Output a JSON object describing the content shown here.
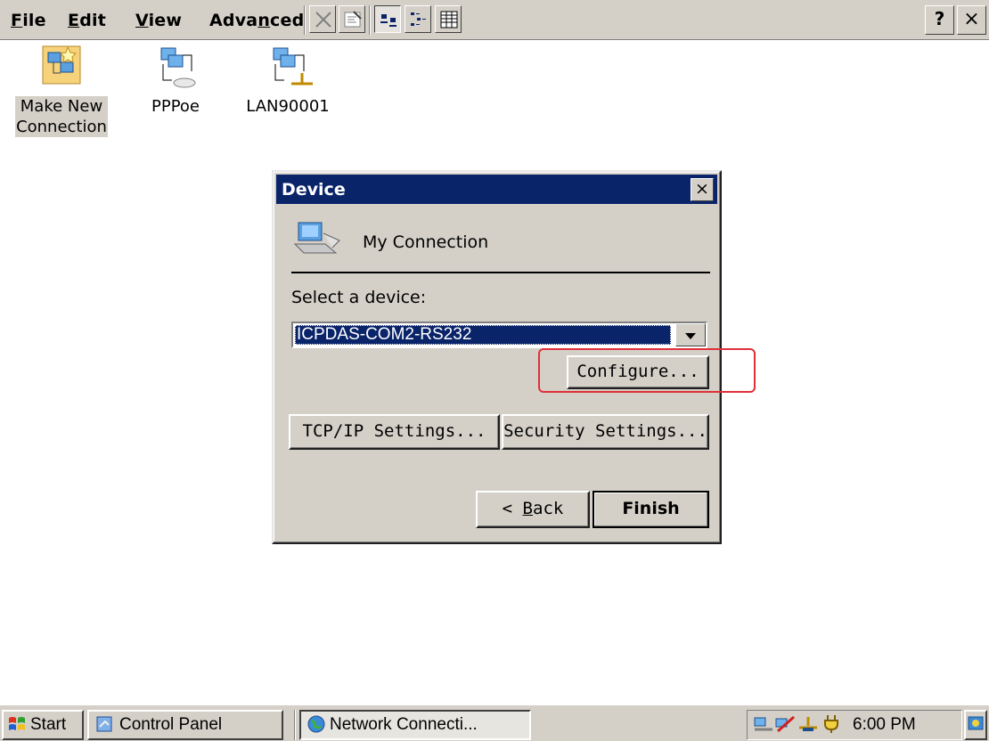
{
  "menu": {
    "items": [
      {
        "pre": "",
        "u": "F",
        "post": "ile"
      },
      {
        "pre": "",
        "u": "E",
        "post": "dit"
      },
      {
        "pre": "",
        "u": "V",
        "post": "iew"
      },
      {
        "pre": "Adva",
        "u": "n",
        "post": "ced"
      }
    ]
  },
  "toolbar": {
    "icons": [
      "delete-icon",
      "properties-icon",
      "large-icons-view-icon",
      "small-icons-view-icon",
      "details-view-icon"
    ],
    "help_label": "?",
    "close_label": "×"
  },
  "desktop_icons": [
    {
      "line1": "Make New",
      "line2": "Connection",
      "icon": "make-new-connection-icon",
      "selected": true
    },
    {
      "line1": "PPPoe",
      "line2": "",
      "icon": "dialup-connection-icon",
      "selected": false
    },
    {
      "line1": "LAN90001",
      "line2": "",
      "icon": "lan-connection-icon",
      "selected": false
    }
  ],
  "dialog": {
    "title": "Device",
    "close_label": "×",
    "connection_name": "My Connection",
    "select_label": "Select a device:",
    "selected_device": "ICPDAS-COM2-RS232",
    "configure_label": "Configure...",
    "tcpip_label": "TCP/IP Settings...",
    "security_label": "Security Settings...",
    "back_pre": "< ",
    "back_u": "B",
    "back_post": "ack",
    "finish_label": "Finish"
  },
  "taskbar": {
    "start_label": "Start",
    "control_panel_label": "Control Panel",
    "network_label": "Network Connecti...",
    "clock": "6:00 PM"
  },
  "colors": {
    "face": "#d4d0c8",
    "titlebar": "#0a246a",
    "highlight_box": "#e0303a"
  }
}
